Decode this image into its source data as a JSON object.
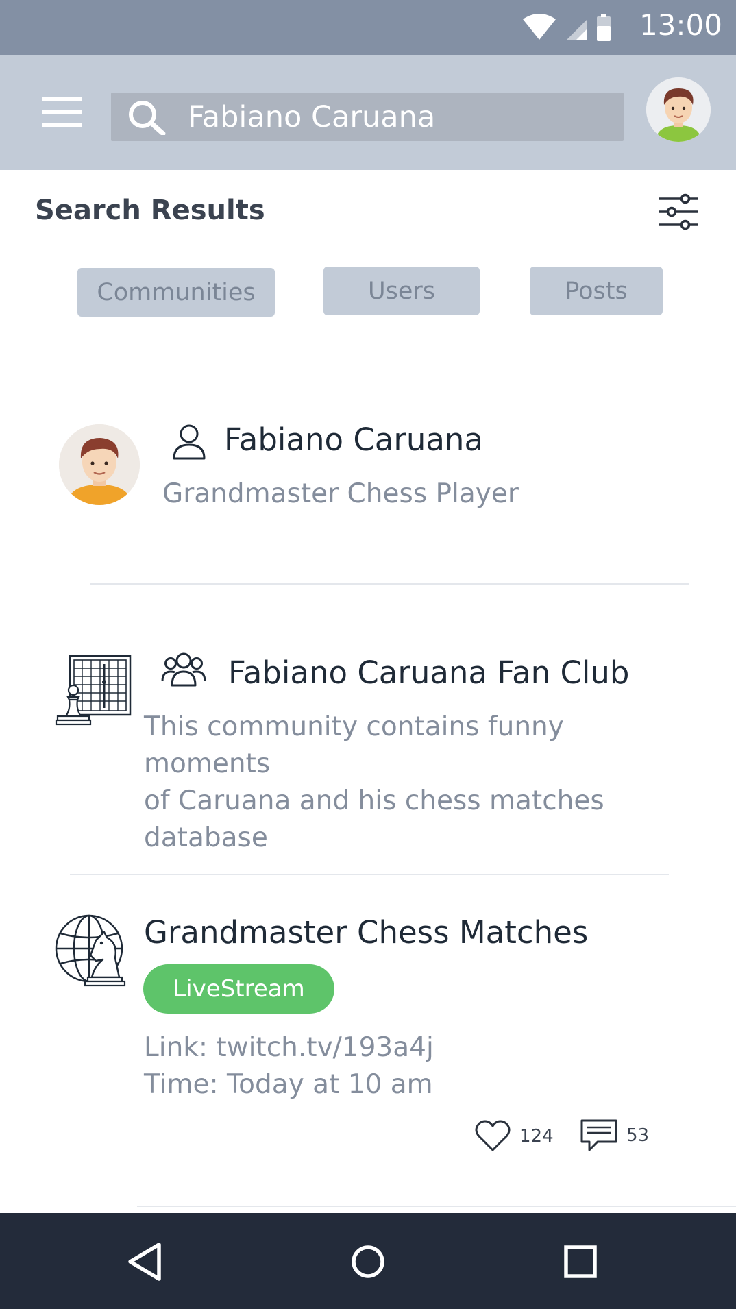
{
  "status_bar": {
    "time": "13:00",
    "icons": [
      "wifi-icon",
      "cellular-signal-icon",
      "battery-icon"
    ]
  },
  "app_bar": {
    "menu_icon": "hamburger-menu-icon",
    "search_icon": "search-icon",
    "search_value": "Fabiano Caruana",
    "profile_avatar": "user-avatar"
  },
  "header": {
    "title": "Search Results",
    "filter_icon": "sliders-icon"
  },
  "tabs": [
    {
      "label": "Communities"
    },
    {
      "label": "Users"
    },
    {
      "label": "Posts"
    }
  ],
  "results": [
    {
      "type_icon": "user-icon",
      "title": "Fabiano Caruana",
      "subtitle": "Grandmaster Chess Player"
    },
    {
      "type_icon": "group-icon",
      "title": "Fabiano Caruana Fan Club",
      "description_lines": [
        "This community contains funny moments",
        "of Caruana and his chess matches",
        "database"
      ]
    },
    {
      "title": "Grandmaster Chess Matches",
      "badge": "LiveStream",
      "link_line": "Link: twitch.tv/193a4j",
      "time_line": "Time: Today at 10 am",
      "likes": "124",
      "comments": "53"
    }
  ],
  "colors": {
    "status_bar": "#8390a4",
    "app_bar": "#c2cbd7",
    "search_box": "#adb4bf",
    "tab_bg": "#c2cbd7",
    "badge": "#5ec46a",
    "nav_bar": "#232b3a"
  },
  "nav_bar": {
    "icons": [
      "back-icon",
      "home-icon",
      "recents-icon"
    ]
  }
}
